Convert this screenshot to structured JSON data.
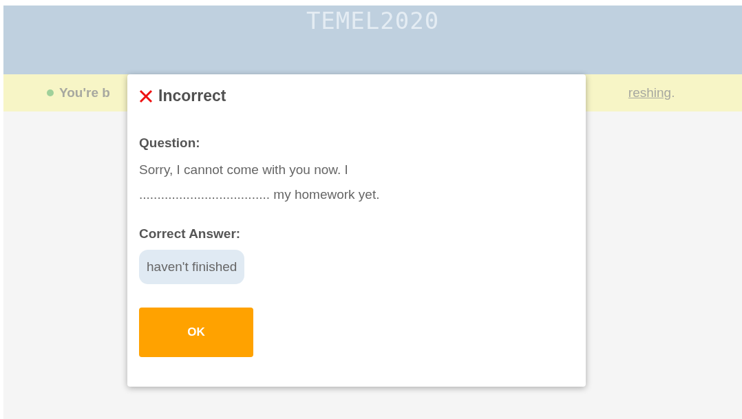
{
  "header": {
    "title": "TEMEL2020"
  },
  "banner": {
    "text_visible": "You're b",
    "link_visible": "reshing",
    "text_end": "."
  },
  "dialog": {
    "result": {
      "kind": "incorrect",
      "label": "Incorrect"
    },
    "question_label": "Question:",
    "question_lines": [
      "Sorry, I cannot come with you now. I",
      ".................................... my homework yet."
    ],
    "answer_label": "Correct Answer:",
    "answer": "haven't finished",
    "button": "OK"
  }
}
